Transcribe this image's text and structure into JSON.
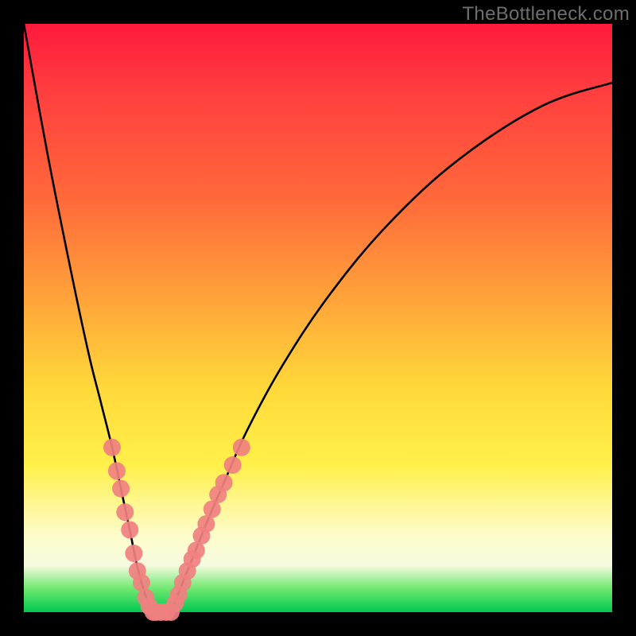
{
  "watermark": "TheBottleneck.com",
  "chart_data": {
    "type": "line",
    "title": "",
    "xlabel": "",
    "ylabel": "",
    "xlim": [
      0,
      100
    ],
    "ylim": [
      0,
      100
    ],
    "grid": false,
    "legend": false,
    "series": [
      {
        "name": "left-curve",
        "x": [
          0,
          4,
          8,
          11,
          13,
          15,
          16.5,
          18,
          19,
          20,
          21,
          22
        ],
        "values": [
          100,
          78,
          58,
          44,
          36,
          28,
          21,
          14,
          9,
          5,
          2,
          0
        ]
      },
      {
        "name": "right-curve",
        "x": [
          25,
          27,
          29,
          31,
          34,
          38,
          44,
          52,
          62,
          74,
          88,
          100
        ],
        "values": [
          0,
          5,
          10,
          15,
          22,
          31,
          42,
          54,
          66,
          77,
          86,
          90
        ]
      }
    ],
    "markers": [
      {
        "name": "left-markers",
        "color": "#f08080",
        "points": [
          {
            "x": 15.0,
            "y": 28
          },
          {
            "x": 15.8,
            "y": 24
          },
          {
            "x": 16.5,
            "y": 21
          },
          {
            "x": 17.2,
            "y": 17
          },
          {
            "x": 18.0,
            "y": 14
          },
          {
            "x": 18.7,
            "y": 10
          },
          {
            "x": 19.3,
            "y": 7
          },
          {
            "x": 20.0,
            "y": 5
          },
          {
            "x": 20.7,
            "y": 2.5
          },
          {
            "x": 21.3,
            "y": 1
          },
          {
            "x": 22.0,
            "y": 0
          }
        ]
      },
      {
        "name": "right-markers",
        "color": "#f08080",
        "points": [
          {
            "x": 25.0,
            "y": 0
          },
          {
            "x": 25.7,
            "y": 1.5
          },
          {
            "x": 26.3,
            "y": 3
          },
          {
            "x": 27.0,
            "y": 5
          },
          {
            "x": 27.8,
            "y": 7
          },
          {
            "x": 28.6,
            "y": 9
          },
          {
            "x": 29.3,
            "y": 10.5
          },
          {
            "x": 30.2,
            "y": 13
          },
          {
            "x": 31.0,
            "y": 15
          },
          {
            "x": 32.0,
            "y": 17.5
          },
          {
            "x": 33.0,
            "y": 20
          },
          {
            "x": 34.0,
            "y": 22
          },
          {
            "x": 35.5,
            "y": 25
          },
          {
            "x": 37.0,
            "y": 28
          }
        ]
      },
      {
        "name": "bottom-markers",
        "color": "#f08080",
        "points": [
          {
            "x": 22.5,
            "y": 0
          },
          {
            "x": 23.3,
            "y": 0
          },
          {
            "x": 24.2,
            "y": 0
          }
        ]
      }
    ]
  }
}
